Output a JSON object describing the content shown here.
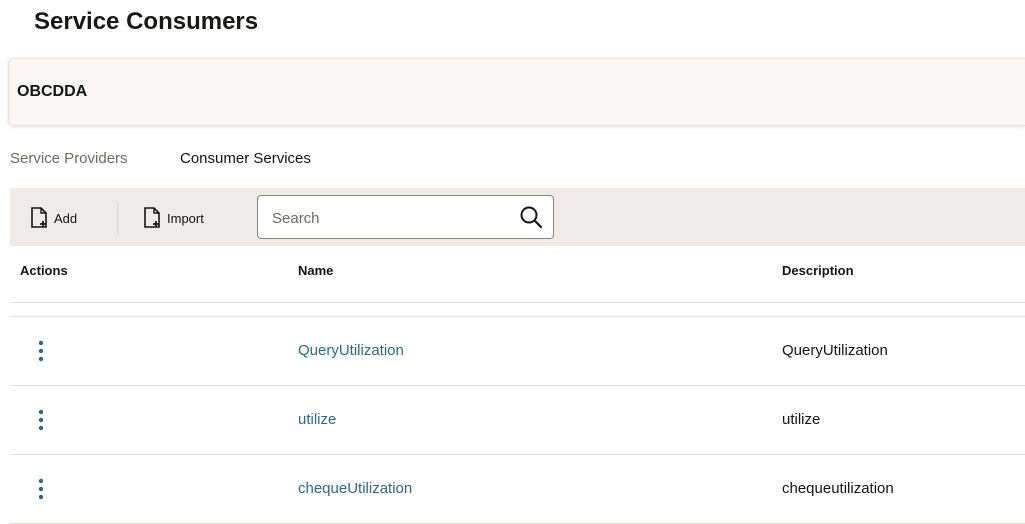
{
  "page": {
    "title": "Service Consumers"
  },
  "consumer": {
    "name": "OBCDDA"
  },
  "tabs": [
    {
      "label": "Service Providers",
      "selected": false
    },
    {
      "label": "Consumer Services",
      "selected": true
    }
  ],
  "toolbar": {
    "add_label": "Add",
    "import_label": "Import",
    "search_placeholder": "Search",
    "search_value": ""
  },
  "table": {
    "headers": {
      "actions": "Actions",
      "name": "Name",
      "description": "Description"
    },
    "rows": [
      {
        "name": "QueryUtilization",
        "description": "QueryUtilization"
      },
      {
        "name": "utilize",
        "description": "utilize"
      },
      {
        "name": "chequeUtilization",
        "description": "chequeutilization"
      }
    ]
  },
  "colors": {
    "link": "#2b6a8a",
    "kebab": "#2b6a8a",
    "toolbar_bg": "#eeebe8",
    "panel_bg": "#faf8f6"
  },
  "icons": {
    "add": "document-add-icon",
    "import": "document-import-icon",
    "search": "search-icon",
    "row_actions": "kebab-menu-icon"
  }
}
